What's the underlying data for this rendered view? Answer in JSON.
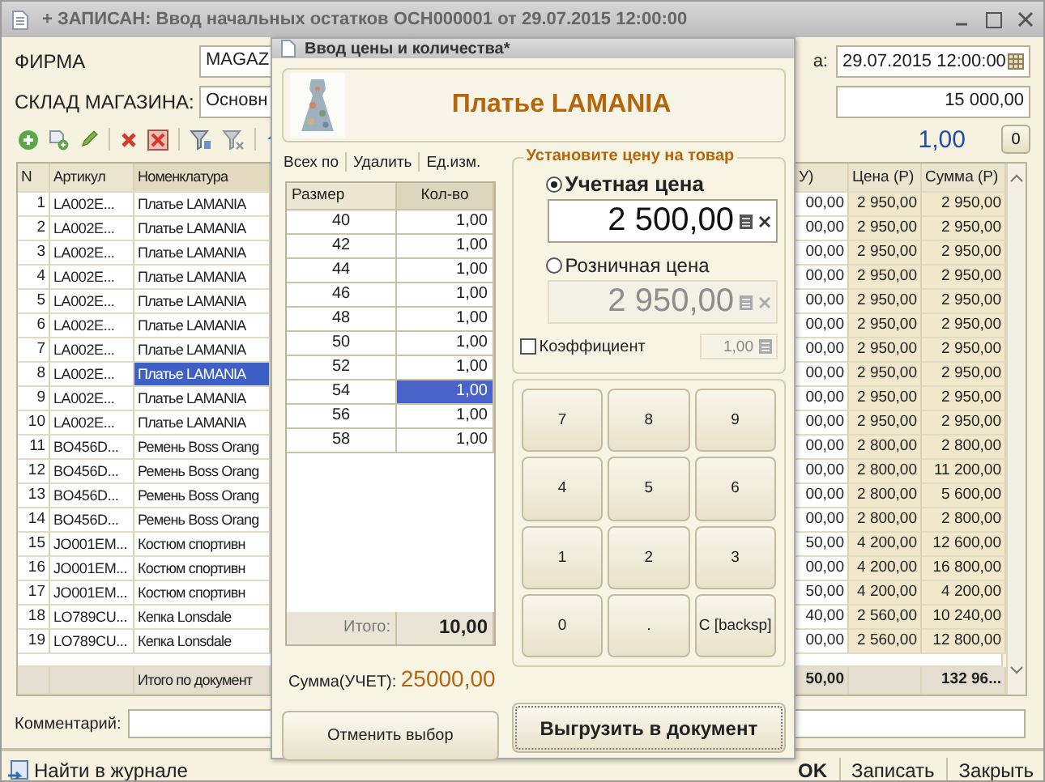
{
  "window": {
    "title": "+ ЗАПИСАН: Ввод начальных остатков ОСН000001 от 29.07.2015 12:00:00"
  },
  "form": {
    "firm_label": "ФИРМА",
    "firm_value": "MAGAZ",
    "warehouse_label": "СКЛАД МАГАЗИНА:",
    "warehouse_value": "Основн",
    "date_label": "а:",
    "date_value": "29.07.2015 12:00:00",
    "amount_value": "15 000,00",
    "quantity": "1,00",
    "zero_button": "0"
  },
  "table": {
    "columns": [
      "N",
      "Артикул",
      "Номенклатура",
      "У)",
      "Цена (Р)",
      "Сумма (Р)"
    ],
    "rows": [
      {
        "cells": [
          "1",
          "LA002E...",
          "Платье LAMANIA",
          "00,00",
          "2 950,00",
          "2 950,00"
        ],
        "selected": false
      },
      {
        "cells": [
          "2",
          "LA002E...",
          "Платье LAMANIA",
          "00,00",
          "2 950,00",
          "2 950,00"
        ],
        "selected": false
      },
      {
        "cells": [
          "3",
          "LA002E...",
          "Платье LAMANIA",
          "00,00",
          "2 950,00",
          "2 950,00"
        ],
        "selected": false
      },
      {
        "cells": [
          "4",
          "LA002E...",
          "Платье LAMANIA",
          "00,00",
          "2 950,00",
          "2 950,00"
        ],
        "selected": false
      },
      {
        "cells": [
          "5",
          "LA002E...",
          "Платье LAMANIA",
          "00,00",
          "2 950,00",
          "2 950,00"
        ],
        "selected": false
      },
      {
        "cells": [
          "6",
          "LA002E...",
          "Платье LAMANIA",
          "00,00",
          "2 950,00",
          "2 950,00"
        ],
        "selected": false
      },
      {
        "cells": [
          "7",
          "LA002E...",
          "Платье LAMANIA",
          "00,00",
          "2 950,00",
          "2 950,00"
        ],
        "selected": false
      },
      {
        "cells": [
          "8",
          "LA002E...",
          "Платье LAMANIA",
          "00,00",
          "2 950,00",
          "2 950,00"
        ],
        "selected": true
      },
      {
        "cells": [
          "9",
          "LA002E...",
          "Платье LAMANIA",
          "00,00",
          "2 950,00",
          "2 950,00"
        ],
        "selected": false
      },
      {
        "cells": [
          "10",
          "LA002E...",
          "Платье LAMANIA",
          "00,00",
          "2 950,00",
          "2 950,00"
        ],
        "selected": false
      },
      {
        "cells": [
          "11",
          "BO456D...",
          "Ремень Boss Orang",
          "00,00",
          "2 800,00",
          "2 800,00"
        ],
        "selected": false
      },
      {
        "cells": [
          "12",
          "BO456D...",
          "Ремень Boss Orang",
          "00,00",
          "2 800,00",
          "11 200,00"
        ],
        "selected": false
      },
      {
        "cells": [
          "13",
          "BO456D...",
          "Ремень Boss Orang",
          "00,00",
          "2 800,00",
          "5 600,00"
        ],
        "selected": false
      },
      {
        "cells": [
          "14",
          "BO456D...",
          "Ремень Boss Orang",
          "00,00",
          "2 800,00",
          "2 800,00"
        ],
        "selected": false
      },
      {
        "cells": [
          "15",
          "JO001EM...",
          "Костюм спортивн",
          "50,00",
          "4 200,00",
          "12 600,00"
        ],
        "selected": false
      },
      {
        "cells": [
          "16",
          "JO001EM...",
          "Костюм спортивн",
          "00,00",
          "4 200,00",
          "16 800,00"
        ],
        "selected": false
      },
      {
        "cells": [
          "17",
          "JO001EM...",
          "Костюм спортивн",
          "50,00",
          "4 200,00",
          "4 200,00"
        ],
        "selected": false
      },
      {
        "cells": [
          "18",
          "LO789CU...",
          "Кепка Lonsdale",
          "40,00",
          "2 560,00",
          "10 240,00"
        ],
        "selected": false
      },
      {
        "cells": [
          "19",
          "LO789CU...",
          "Кепка Lonsdale",
          "00,00",
          "2 560,00",
          "12 800,00"
        ],
        "selected": false
      }
    ],
    "footer": {
      "label": "Итого по документ",
      "partial": "50,00",
      "sum": "132 96..."
    }
  },
  "comment_label": "Комментарий:",
  "bottom": {
    "find_button": "Найти в журнале",
    "buttons": [
      "OK",
      "Записать",
      "Закрыть"
    ]
  },
  "dialog": {
    "title": "Ввод цены и количества*",
    "product": "Платье LAMANIA",
    "toolbar": [
      "Всех по",
      "Удалить",
      "Ед.изм."
    ],
    "sizes": {
      "columns": [
        "Размер",
        "Кол-во"
      ],
      "rows": [
        {
          "size": "40",
          "qty": "1,00",
          "selected": false
        },
        {
          "size": "42",
          "qty": "1,00",
          "selected": false
        },
        {
          "size": "44",
          "qty": "1,00",
          "selected": false
        },
        {
          "size": "46",
          "qty": "1,00",
          "selected": false
        },
        {
          "size": "48",
          "qty": "1,00",
          "selected": false
        },
        {
          "size": "50",
          "qty": "1,00",
          "selected": false
        },
        {
          "size": "52",
          "qty": "1,00",
          "selected": false
        },
        {
          "size": "54",
          "qty": "1,00",
          "selected": true
        },
        {
          "size": "56",
          "qty": "1,00",
          "selected": false
        },
        {
          "size": "58",
          "qty": "1,00",
          "selected": false
        }
      ],
      "total_label": "Итого:",
      "total": "10,00"
    },
    "sum_label": "Сумма(УЧЕТ):",
    "sum_value": "25000,00",
    "price_group": {
      "title": "Установите цену на товар",
      "options": [
        {
          "label": "Учетная цена",
          "value": "2 500,00",
          "selected": true
        },
        {
          "label": "Розничная цена",
          "value": "2 950,00",
          "selected": false
        }
      ],
      "coefficient": {
        "label": "Коэффициент",
        "checked": false,
        "value": "1,00"
      }
    },
    "keypad": [
      "7",
      "8",
      "9",
      "4",
      "5",
      "6",
      "1",
      "2",
      "3",
      "0",
      ".",
      "C [backsp]"
    ],
    "cancel_button": "Отменить выбор",
    "export_button": "Выгрузить в документ"
  }
}
